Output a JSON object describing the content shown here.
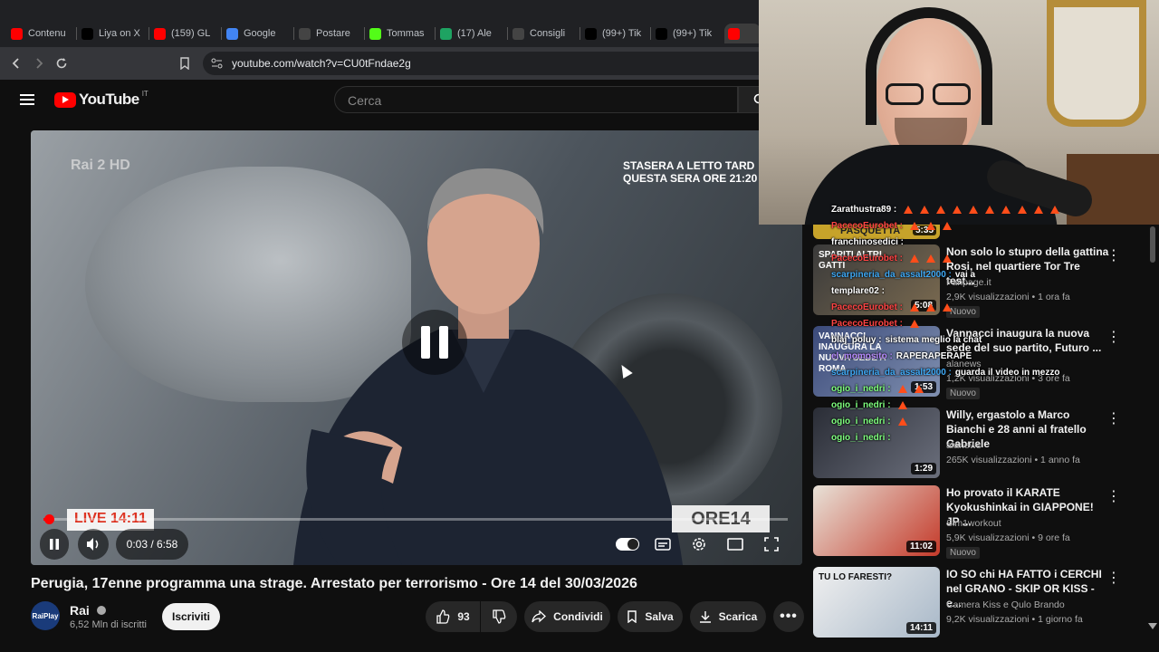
{
  "browser": {
    "tabs": [
      {
        "label": "Contenu",
        "icon": "youtube-icon",
        "color": "#ff0000"
      },
      {
        "label": "Liya on X",
        "icon": "x-icon",
        "color": "#000000"
      },
      {
        "label": "(159) GL",
        "icon": "youtube-icon",
        "color": "#ff0000"
      },
      {
        "label": "Google",
        "icon": "google-translate-icon",
        "color": "#4285f4"
      },
      {
        "label": "Postare",
        "icon": "chatgpt-icon",
        "color": "#444444"
      },
      {
        "label": "Tommas",
        "icon": "kick-icon",
        "color": "#53fc18"
      },
      {
        "label": "(17) Ale",
        "icon": "edit-icon",
        "color": "#1ea362"
      },
      {
        "label": "Consigli",
        "icon": "chatgpt-icon",
        "color": "#444444"
      },
      {
        "label": "(99+) Tik",
        "icon": "tiktok-icon",
        "color": "#000000"
      },
      {
        "label": "(99+) Tik",
        "icon": "tiktok-icon",
        "color": "#000000"
      },
      {
        "label": "",
        "icon": "youtube-icon",
        "color": "#ff0000"
      }
    ],
    "url": "youtube.com/watch?v=CU0tFndae2g"
  },
  "youtube": {
    "logo": "YouTube",
    "country": "IT",
    "search_placeholder": "Cerca"
  },
  "video": {
    "channel_bug": "Rai 2 HD",
    "promo_line1": "STASERA A LETTO TARD",
    "promo_line2": "QUESTA SERA  ORE 21:20",
    "live_badge": "LIVE 14:11",
    "ore_badge": "ORE14",
    "time": "0:03 / 6:58",
    "progress_fraction": 0.007,
    "title": "Perugia, 17enne programma una strage. Arrestato per terrorismo - Ore 14 del 30/03/2026"
  },
  "channel": {
    "name": "Rai",
    "avatar_text": "RaiPlay",
    "subscribers": "6,52 Mln di iscritti",
    "subscribe_label": "Iscriviti"
  },
  "actions": {
    "likes": "93",
    "share": "Condividi",
    "save": "Salva",
    "download": "Scarica"
  },
  "recommendations": [
    {
      "title": "Non solo lo stupro della gattina Rosi, nel quartiere Tor Tre test...",
      "channel": "Fanpage.it",
      "views": "2,9K visualizzazioni • 1 ora fa",
      "badge": "Nuovo",
      "duration": "5:08",
      "thumb_text": "SPARITI ALTRI GATTI"
    },
    {
      "title": "Vannacci inaugura la nuova sede del suo partito, Futuro ...",
      "channel": "alanews",
      "views": "1,2K visualizzazioni • 3 ore fa",
      "badge": "Nuovo",
      "duration": "1:53",
      "thumb_text": "VANNACCI INAUGURA LA NUOVA SEDE A ROMA"
    },
    {
      "title": "Willy, ergastolo a Marco Bianchi e 28 anni al fratello Gabriele",
      "channel": "alanews",
      "views": "265K visualizzazioni • 1 anno fa",
      "badge": "",
      "duration": "1:29",
      "thumb_text": ""
    },
    {
      "title": "Ho provato il KARATE Kyokushinkai in GIAPPONE! JP ...",
      "channel": "Sim1workout",
      "views": "5,9K visualizzazioni • 9 ore fa",
      "badge": "Nuovo",
      "duration": "11:02",
      "thumb_text": ""
    },
    {
      "title": "IO SO chi HA FATTO i CERCHI nel GRANO - SKIP OR KISS - e...",
      "channel": "Camera Kiss e Qulo Brando",
      "views": "9,2K visualizzazioni • 1 giorno fa",
      "badge": "",
      "duration": "14:11",
      "thumb_text": "TU LO FARESTI?"
    }
  ],
  "top_thumb_text": "PASQUETTA",
  "top_thumb_duration": "5:35",
  "chat": [
    {
      "user": "Zarathustra89 :",
      "msg": "",
      "color": "#ffffff"
    },
    {
      "user": "PacecoEurobet :",
      "msg": "",
      "color": "#ff4444"
    },
    {
      "user": "franchinosedici :",
      "msg": "",
      "color": "#ffffff"
    },
    {
      "user": "PacecoEurobet :",
      "msg": "",
      "color": "#ff4444"
    },
    {
      "user": "scarpineria_da_assalt2000 :",
      "msg": "vai a",
      "color": "#3fa9f5"
    },
    {
      "user": "templare02 :",
      "msg": "",
      "color": "#ffffff"
    },
    {
      "user": "PacecoEurobet :",
      "msg": "",
      "color": "#ff4444"
    },
    {
      "user": "PacecoEurobet :",
      "msg": "",
      "color": "#ff4444"
    },
    {
      "user": "blaj_poluy :",
      "msg": "sistema meglio la chat",
      "color": "#ffffff"
    },
    {
      "user": "el_momosito :",
      "msg": "RAPERAPERAPE",
      "color": "#b388ff"
    },
    {
      "user": "scarpineria_da_assalt2000 :",
      "msg": "guarda il video in mezzo",
      "color": "#3fa9f5"
    },
    {
      "user": "ogio_i_nedri :",
      "msg": "",
      "color": "#7fff7f"
    },
    {
      "user": "ogio_i_nedri :",
      "msg": "",
      "color": "#7fff7f"
    },
    {
      "user": "ogio_i_nedri :",
      "msg": "",
      "color": "#7fff7f"
    },
    {
      "user": "ogio_i_nedri :",
      "msg": "",
      "color": "#7fff7f"
    }
  ]
}
